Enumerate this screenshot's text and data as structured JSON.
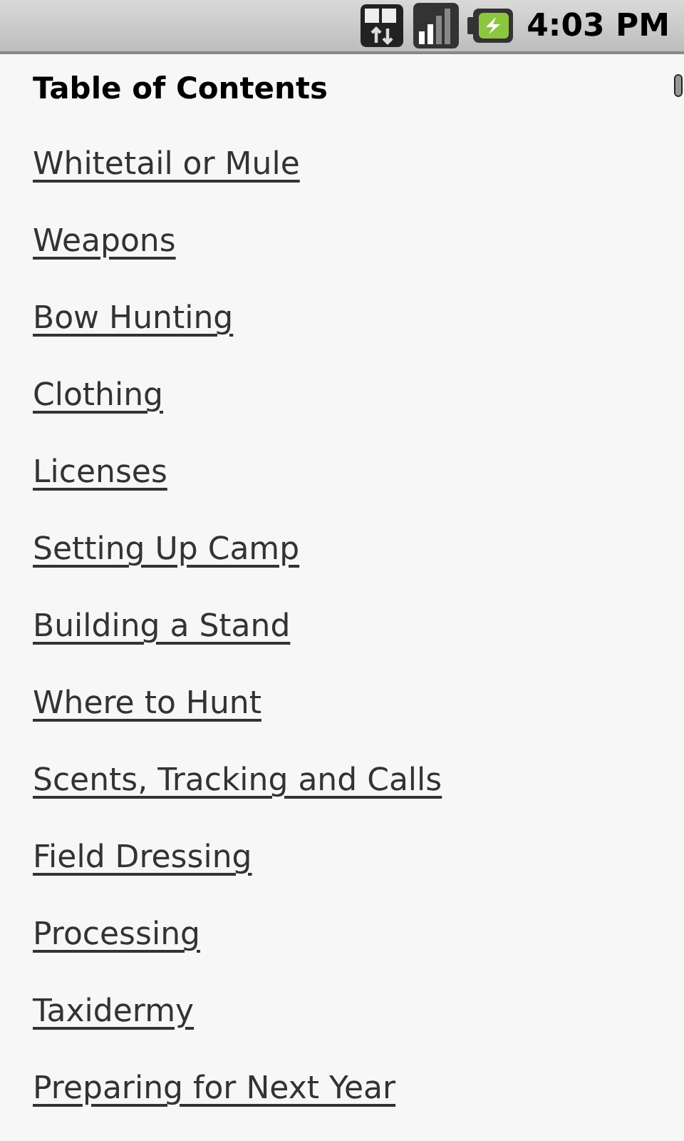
{
  "status_bar": {
    "time": "4:03 PM"
  },
  "heading": "Table of Contents",
  "links": [
    "Whitetail or Mule",
    "Weapons",
    "Bow Hunting",
    "Clothing",
    "Licenses",
    "Setting Up Camp",
    "Building a Stand",
    "Where to Hunt",
    "Scents, Tracking and Calls",
    "Field Dressing",
    "Processing",
    "Taxidermy",
    "Preparing for Next Year"
  ]
}
